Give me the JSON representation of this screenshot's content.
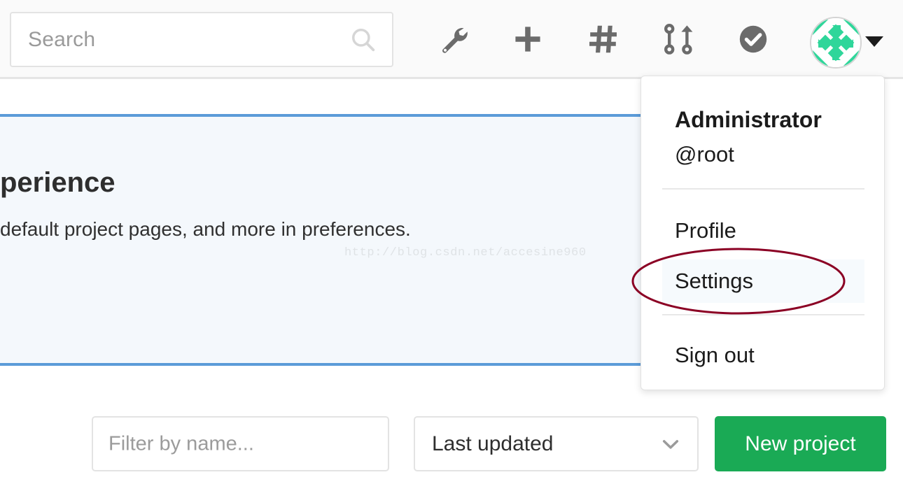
{
  "header": {
    "search": {
      "placeholder": "Search",
      "value": "",
      "icon": "search-icon"
    },
    "icons": [
      {
        "name": "wrench-icon",
        "label": "Admin area"
      },
      {
        "name": "plus-icon",
        "label": "New"
      },
      {
        "name": "hashtag-icon",
        "label": "Issues"
      },
      {
        "name": "merge-request-icon",
        "label": "Merge requests"
      },
      {
        "name": "check-circle-icon",
        "label": "Todos"
      }
    ],
    "avatar": {
      "name": "avatar",
      "alt": "Administrator avatar",
      "pattern_color": "#2fd69a",
      "background_color": "#ffffff"
    },
    "caret": "chevron-down-icon"
  },
  "banner": {
    "title": "perience",
    "description": "default project pages, and more in preferences.",
    "accent_color": "#5b9bd8",
    "background_color": "#f4f8fc"
  },
  "watermark": {
    "text": "http://blog.csdn.net/accesine960"
  },
  "user_dropdown": {
    "name": "Administrator",
    "handle": "@root",
    "items": [
      {
        "label": "Profile",
        "selected": false
      },
      {
        "label": "Settings",
        "selected": true
      },
      {
        "label": "Sign out",
        "selected": false
      }
    ]
  },
  "toolbar": {
    "filter": {
      "placeholder": "Filter by name...",
      "value": ""
    },
    "sort": {
      "selected": "Last updated",
      "icon": "chevron-down-icon"
    },
    "new_project_label": "New project",
    "new_project_color": "#1aaa55"
  },
  "annotation": {
    "shape": "ellipse",
    "target": "Settings",
    "color": "#8b0024"
  }
}
